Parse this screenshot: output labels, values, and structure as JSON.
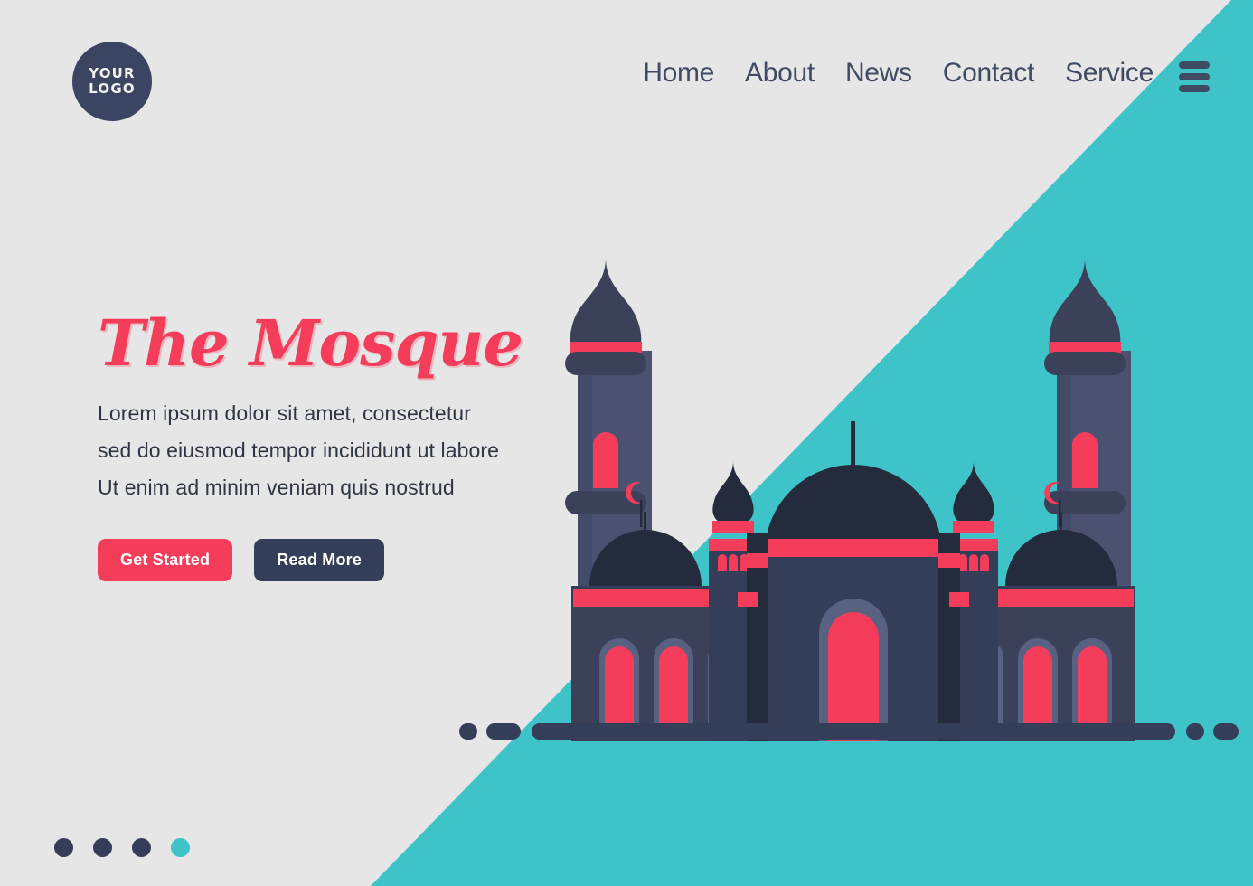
{
  "header": {
    "logo": {
      "line1": "YOUR",
      "line2": "LOGO",
      "name": "your-logo"
    },
    "nav": [
      {
        "label": "Home"
      },
      {
        "label": "About"
      },
      {
        "label": "News"
      },
      {
        "label": "Contact"
      },
      {
        "label": "Service"
      }
    ],
    "menu_icon": "hamburger-menu-icon"
  },
  "hero": {
    "title": "The Mosque",
    "description_lines": [
      "Lorem ipsum dolor sit amet, consectetur",
      "sed do eiusmod tempor incididunt ut labore",
      "Ut enim ad minim veniam quis nostrud"
    ],
    "description": "Lorem ipsum dolor sit amet, consectetur sed do eiusmod tempor incididunt ut labore Ut enim ad minim veniam quis nostrud",
    "primary_button": "Get Started",
    "secondary_button": "Read More"
  },
  "pagination": {
    "total": 4,
    "active_index": 3,
    "dots": [
      "slide-1",
      "slide-2",
      "slide-3",
      "slide-4"
    ]
  },
  "illustration": {
    "name": "mosque-illustration",
    "elements": [
      "left-minaret",
      "right-minaret",
      "central-dome",
      "left-side-dome",
      "right-side-dome",
      "left-small-tower",
      "right-small-tower",
      "crescent-finial",
      "entrance-arch",
      "ground-line"
    ]
  },
  "colors": {
    "background": "#E6E6E6",
    "teal": "#3EC3C9",
    "pink": "#F43D5B",
    "navy_dark": "#242B3D",
    "navy": "#343E59",
    "navy_mid": "#3A4159",
    "navy_light": "#4A5270",
    "navy_lighter": "#58618080",
    "text": "#2F3542",
    "nav_text": "#3F4A63",
    "white": "#FFFFFF"
  }
}
